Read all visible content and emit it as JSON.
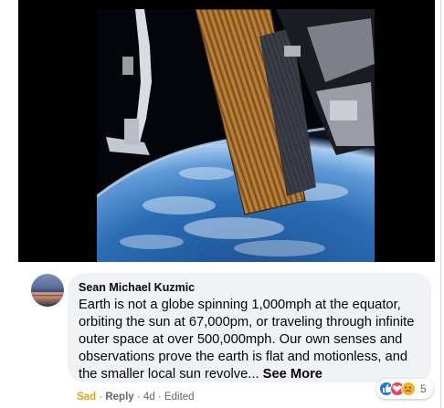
{
  "comment": {
    "author": "Sean Michael Kuzmic",
    "text": "Earth is not a globe spinning 1,000mph at the equator, orbiting the sun at 67,000pm, or traveling through infinite outer space at over 500,000mph. Our own senses and observations prove the earth is flat and motionless, and the smaller local sun revolve...",
    "see_more": "See More"
  },
  "actions": {
    "reaction": "Sad",
    "sep1": "·",
    "reply": "Reply",
    "sep2": "·",
    "time": "4d",
    "sep3": "·",
    "edited": "Edited"
  },
  "reactions": {
    "icons": [
      "like-icon",
      "love-icon",
      "sad-icon"
    ],
    "count": "5"
  },
  "colors": {
    "like": "#1877f2",
    "love": "#f33e58",
    "sad": "#f7b125",
    "bubble": "#f0f2f5"
  }
}
